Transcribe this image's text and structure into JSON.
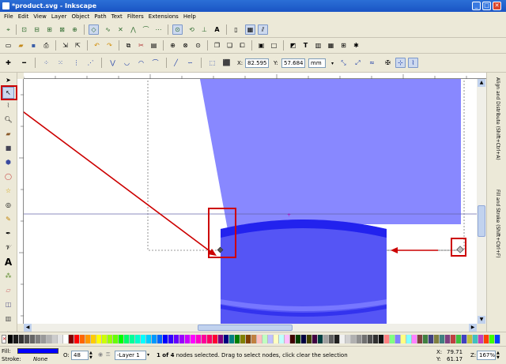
{
  "window": {
    "title": "*product.svg - Inkscape",
    "min": "_",
    "max": "□",
    "close": "✕"
  },
  "menu": [
    "File",
    "Edit",
    "View",
    "Layer",
    "Object",
    "Path",
    "Text",
    "Filters",
    "Extensions",
    "Help"
  ],
  "node_toolbar": {
    "x_label": "X:",
    "x_value": "82.595",
    "y_label": "Y:",
    "y_value": "57.684",
    "unit": "mm"
  },
  "dock": {
    "panel1": "Align and Distribute (Shift+Ctrl+A)",
    "panel2": "Fill and Stroke (Shift+Ctrl+F)"
  },
  "status": {
    "fill_label": "Fill:",
    "stroke_label": "Stroke:",
    "stroke_value": "None",
    "opacity_label": "O:",
    "opacity_value": "48",
    "layer": "-Layer 1",
    "message_bold": "1 of 4",
    "message": " nodes selected. Drag to select nodes, click clear the selection",
    "x_label": "X:",
    "x_value": "79.71",
    "y_label": "Y:",
    "y_value": "61.17",
    "zoom_label": "Z:",
    "zoom_value": "167%"
  },
  "colors": {
    "fill": "#0000ff",
    "shape_light": "#8888ff",
    "shape_dark": "#5555f5",
    "highlight": "#cc0000",
    "title_bar": "#1a54c4"
  },
  "palette_colors": [
    "#000000",
    "#1a1a1a",
    "#333333",
    "#4d4d4d",
    "#666666",
    "#808080",
    "#999999",
    "#b3b3b3",
    "#cccccc",
    "#e6e6e6",
    "#ffffff",
    "#800000",
    "#ff0000",
    "#ff6600",
    "#ff9900",
    "#ffcc00",
    "#ffff00",
    "#ccff00",
    "#99ff00",
    "#66ff00",
    "#00ff00",
    "#00ff66",
    "#00ff99",
    "#00ffcc",
    "#00ffff",
    "#00ccff",
    "#0099ff",
    "#0066ff",
    "#0000ff",
    "#3300ff",
    "#6600ff",
    "#9900ff",
    "#cc00ff",
    "#ff00ff",
    "#ff00cc",
    "#ff0099",
    "#ff0066",
    "#ff0033",
    "#800080",
    "#000080",
    "#008080",
    "#008000",
    "#808000",
    "#804000",
    "#c08040",
    "#ffc0c0",
    "#c0ffc0",
    "#c0c0ff",
    "#ffffc0",
    "#c0ffff",
    "#ffc0ff",
    "#400000",
    "#004000",
    "#000040",
    "#404000",
    "#400040",
    "#004040",
    "#a0a0a0",
    "#606060",
    "#202020",
    "#f0f0f0",
    "#d0d0d0",
    "#b0b0b0",
    "#909090",
    "#707070",
    "#505050",
    "#303030",
    "#101010",
    "#ff8080",
    "#80ff80",
    "#8080ff",
    "#ffff80",
    "#80ffff",
    "#ff80ff",
    "#804040",
    "#408040",
    "#404080",
    "#808040",
    "#408080",
    "#804080",
    "#c04040",
    "#40c040",
    "#4040c0",
    "#c0c040",
    "#40c0c0",
    "#c040c0",
    "#ff4000",
    "#40ff00",
    "#0040ff"
  ],
  "icons": [
    "select-tool",
    "node-tool",
    "tweak-tool",
    "zoom-tool",
    "measure-tool",
    "rectangle-tool",
    "3dbox-tool",
    "ellipse-tool",
    "star-tool",
    "spiral-tool",
    "pencil-tool",
    "pen-tool",
    "calligraphy-tool",
    "text-tool",
    "spray-tool",
    "eraser-tool",
    "bucket-tool",
    "gradient-tool",
    "dropper-tool"
  ]
}
